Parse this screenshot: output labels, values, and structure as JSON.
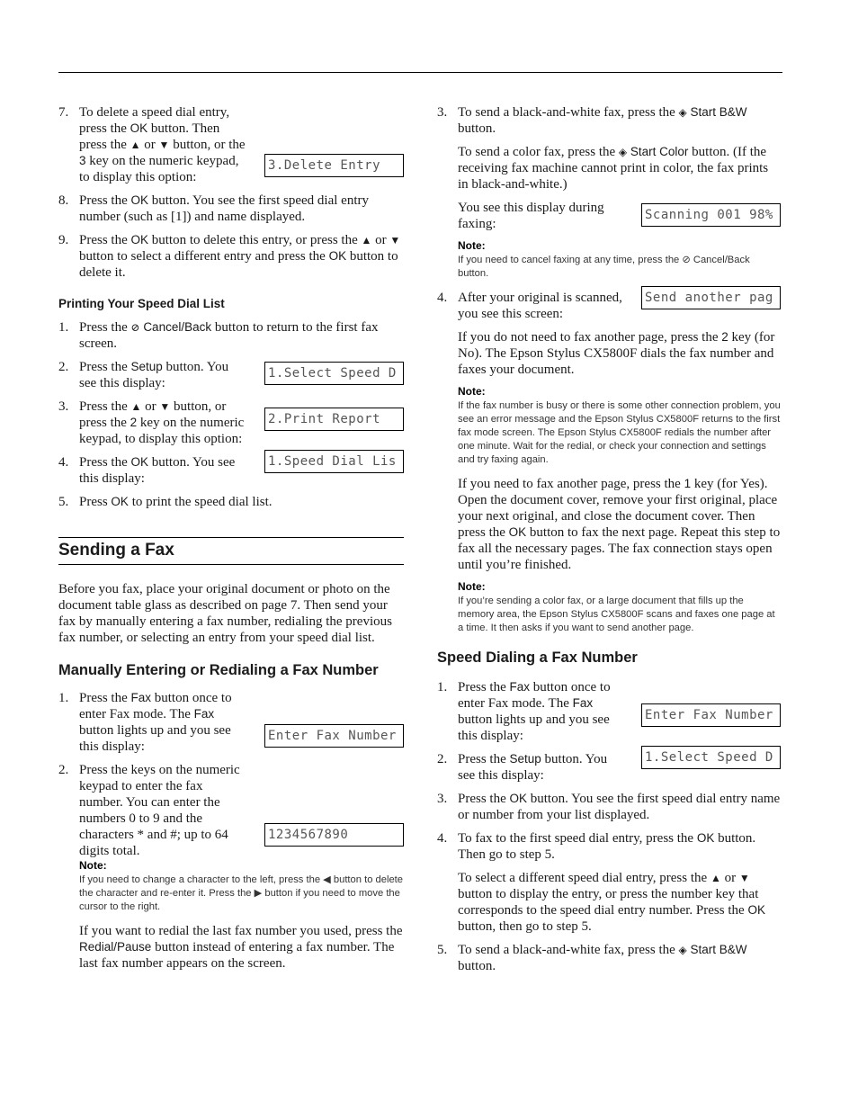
{
  "left": {
    "delete_steps": [
      {
        "num": "7.",
        "text_a": "To delete a speed dial entry, press the ",
        "ok": "OK",
        "text_b": " button. Then press the ",
        "up": "▲",
        "or": " or ",
        "down": "▼",
        "text_c": " button, or the ",
        "key": "3",
        "text_d": " key on the numeric keypad, to display this option:",
        "lcd": "3.Delete Entry"
      },
      {
        "num": "8.",
        "text_a": "Press the ",
        "ok": "OK",
        "text_b": " button. You see the first speed dial entry number (such as [1]) and name displayed."
      },
      {
        "num": "9.",
        "text_a": "Press the ",
        "ok": "OK",
        "text_b": " button to delete this entry, or press the ",
        "up": "▲",
        "or": " or ",
        "down": "▼",
        "text_c": " button to select a different entry and press the ",
        "ok2": "OK",
        "text_d": " button to delete it."
      }
    ],
    "print_list": {
      "heading": "Printing Your Speed Dial List",
      "steps": [
        {
          "num": "1.",
          "text_a": "Press the ",
          "icon": "⊘",
          "btn": "Cancel/Back",
          "text_b": " button to return to the first fax screen."
        },
        {
          "num": "2.",
          "text_a": "Press the ",
          "btn": "Setup",
          "text_b": " button. You see this display:",
          "lcd": "1.Select Speed D"
        },
        {
          "num": "3.",
          "text_a": "Press the ",
          "up": "▲",
          "or": " or ",
          "down": "▼",
          "text_b": " button, or press the ",
          "key": "2",
          "text_c": " key on the numeric keypad, to display this option:",
          "lcd": "2.Print Report"
        },
        {
          "num": "4.",
          "text_a": "Press the ",
          "btn": "OK",
          "text_b": " button. You see this display:",
          "lcd": "1.Speed Dial Lis"
        },
        {
          "num": "5.",
          "text_a": "Press ",
          "btn": "OK",
          "text_b": " to print the speed dial list."
        }
      ]
    },
    "sending": {
      "heading": "Sending a Fax",
      "intro": "Before you fax, place your original document or photo on the document table glass as described on page 7. Then send your fax by manually entering a fax number, redialing the previous fax number, or selecting an entry from your speed dial list."
    },
    "manual": {
      "heading": "Manually Entering or Redialing a Fax Number",
      "steps": [
        {
          "num": "1.",
          "text_a": "Press the ",
          "btn": "Fax",
          "text_b": " button once to enter Fax mode. The ",
          "btn2": "Fax",
          "text_c": " button lights up and you see this display:",
          "lcd": "Enter Fax Number"
        },
        {
          "num": "2.",
          "text_a": "Press the keys on the numeric keypad to enter the fax number. You can enter the numbers 0 to 9 and the characters * and #; up to 64 digits total.",
          "lcd": "1234567890"
        }
      ],
      "note_label": "Note:",
      "note_a": "If you need to change a character to the left, press the ",
      "note_left": "◀",
      "note_b": " button to delete the character and re-enter it. Press the ",
      "note_right": "▶",
      "note_c": " button if you need to move the cursor to the right.",
      "redial_a": "If you want to redial the last fax number you used, press the ",
      "redial_btn": "Redial/Pause",
      "redial_b": " button instead of entering a fax number. The last fax number appears on the screen."
    }
  },
  "right": {
    "step3": {
      "num": "3.",
      "bw_a": "To send a black-and-white fax, press the ",
      "bw_icon": "◈",
      "bw_btn": "Start B&W",
      "bw_b": " button.",
      "color_a": "To send a color fax, press the ",
      "color_icon": "◈",
      "color_btn": "Start Color",
      "color_b": " button. (If the receiving fax machine cannot print in color, the fax prints in black-and-white.)",
      "during": "You see this display during faxing:",
      "lcd": "Scanning 001 98%",
      "note_label": "Note:",
      "note_a": "If you need to cancel faxing at any time, press the ",
      "note_icon": "⊘",
      "note_btn": "Cancel/Back",
      "note_b": " button."
    },
    "step4": {
      "num": "4.",
      "text": "After your original is scanned, you see this screen:",
      "lcd": "Send another pag",
      "no_a": "If you do not need to fax another page, press the ",
      "no_key": "2",
      "no_b": " key (for No). The Epson Stylus CX5800F dials the fax number and faxes your document.",
      "note1_label": "Note:",
      "note1": "If the fax number is busy or there is some other connection problem, you see an error message and the Epson Stylus CX5800F returns to the first fax mode screen. The Epson Stylus CX5800F redials the number after one minute. Wait for the redial, or check your connection and settings and try faxing again.",
      "yes_a": "If you need to fax another page, press the ",
      "yes_key": "1",
      "yes_b": " key (for Yes). Open the document cover, remove your first original, place your next original, and close the document cover. Then press the ",
      "yes_ok": "OK",
      "yes_c": " button to fax the next page. Repeat this step to fax all the necessary pages. The fax connection stays open until you’re finished.",
      "note2_label": "Note:",
      "note2": "If you’re sending a color fax, or a large document that fills up the memory area, the Epson Stylus CX5800F scans and faxes one page at a time. It then asks if you want to send another page."
    },
    "speed": {
      "heading": "Speed Dialing a Fax Number",
      "steps": [
        {
          "num": "1.",
          "text_a": "Press the ",
          "btn": "Fax",
          "text_b": " button once to enter Fax mode. The ",
          "btn2": "Fax",
          "text_c": " button lights up and you see this display:",
          "lcd": "Enter Fax Number"
        },
        {
          "num": "2.",
          "text_a": "Press the ",
          "btn": "Setup",
          "text_b": " button. You see this display:",
          "lcd": "1.Select Speed D"
        },
        {
          "num": "3.",
          "text_a": "Press the ",
          "btn": "OK",
          "text_b": " button. You see the first speed dial entry name or number from your list displayed."
        },
        {
          "num": "4.",
          "text_a": "To fax to the first speed dial entry, press the ",
          "btn": "OK",
          "text_b": " button. Then go to step 5.",
          "p2_a": "To select a different speed dial entry, press the ",
          "up": "▲",
          "or": " or ",
          "down": "▼",
          "p2_b": " button to display the entry, or press the number key that corresponds to the speed dial entry number. Press the ",
          "p2_ok": "OK",
          "p2_c": " button, then go to step 5."
        },
        {
          "num": "5.",
          "text_a": "To send a black-and-white fax, press the ",
          "icon": "◈",
          "btn": "Start B&W",
          "text_b": " button."
        }
      ]
    }
  }
}
